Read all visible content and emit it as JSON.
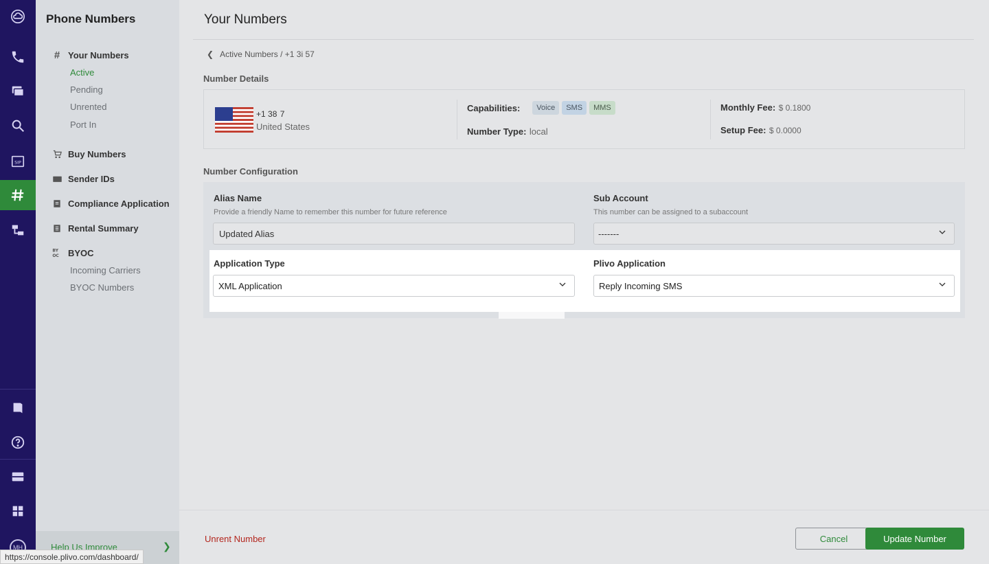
{
  "sidebar": {
    "title": "Phone Numbers",
    "your_numbers": "Your Numbers",
    "your_numbers_items": [
      "Active",
      "Pending",
      "Unrented",
      "Port In"
    ],
    "buy_numbers": "Buy Numbers",
    "sender_ids": "Sender IDs",
    "compliance": "Compliance Application",
    "rental_summary": "Rental Summary",
    "byoc": "BYOC",
    "byoc_items": [
      "Incoming Carriers",
      "BYOC Numbers"
    ],
    "help": "Help Us Improve",
    "status_url": "https://console.plivo.com/dashboard/"
  },
  "header": {
    "title": "Your Numbers",
    "breadcrumb": "Active Numbers / +1 3і          57"
  },
  "details": {
    "section_label": "Number Details",
    "number": "+1 38            7",
    "country": "United States",
    "capabilities_label": "Capabilities:",
    "capabilities": [
      "Voice",
      "SMS",
      "MMS"
    ],
    "number_type_label": "Number Type:",
    "number_type": "local",
    "monthly_fee_label": "Monthly Fee:",
    "monthly_fee": "$ 0.1800",
    "setup_fee_label": "Setup Fee:",
    "setup_fee": "$ 0.0000"
  },
  "config": {
    "section_label": "Number Configuration",
    "alias_title": "Alias Name",
    "alias_hint": "Provide a friendly Name to remember this number for future reference",
    "alias_value": "Updated Alias",
    "sub_title": "Sub Account",
    "sub_hint": "This number can be assigned to a subaccount",
    "sub_value": "-------",
    "app_type_title": "Application Type",
    "app_type_value": "XML Application",
    "plivo_app_title": "Plivo Application",
    "plivo_app_value": "Reply Incoming SMS"
  },
  "footer": {
    "unrent": "Unrent Number",
    "cancel": "Cancel",
    "update": "Update Number"
  },
  "colors": {
    "rail": "#1f1560",
    "accent": "#2f8a3a",
    "danger": "#b3261e"
  },
  "icons": [
    "cloud-icon",
    "phone-icon",
    "chat-icon",
    "search-icon",
    "sip-icon",
    "hash-icon",
    "flow-icon",
    "book-icon",
    "help-icon",
    "billing-icon",
    "apps-icon"
  ]
}
